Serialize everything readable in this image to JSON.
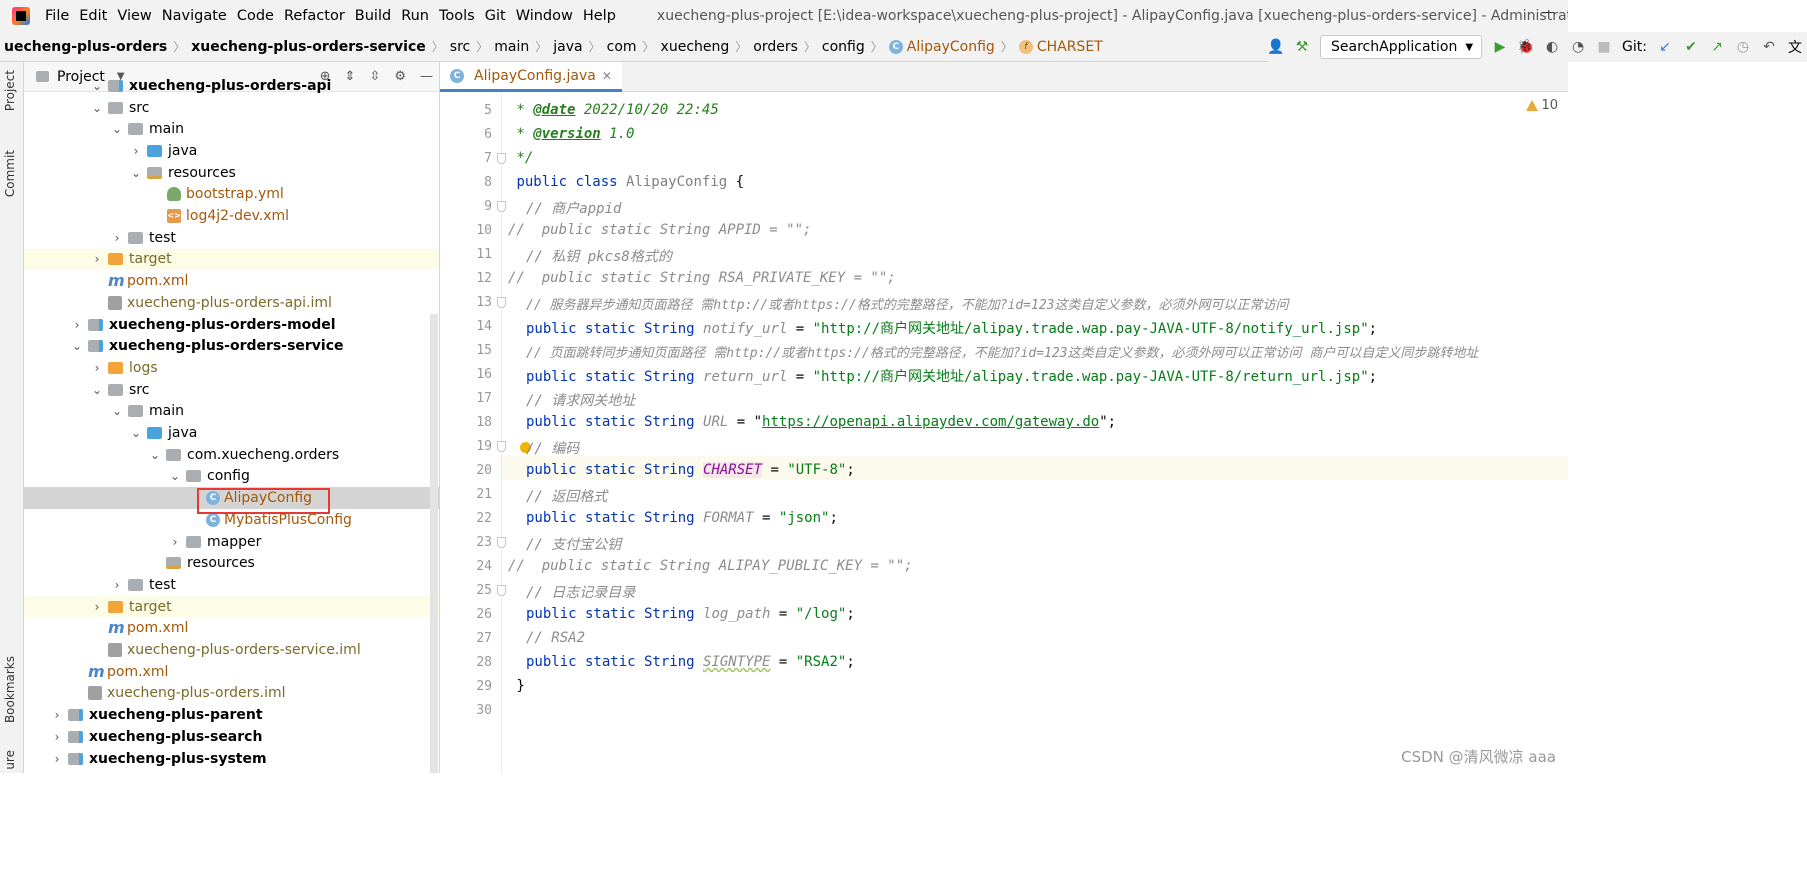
{
  "menubar": {
    "items": [
      "File",
      "Edit",
      "View",
      "Navigate",
      "Code",
      "Refactor",
      "Build",
      "Run",
      "Tools",
      "Git",
      "Window",
      "Help"
    ],
    "title": "xuecheng-plus-project [E:\\idea-workspace\\xuecheng-plus-project] - AlipayConfig.java [xuecheng-plus-orders-service] - Administrator"
  },
  "breadcrumbs": [
    "uecheng-plus-orders",
    "xuecheng-plus-orders-service",
    "src",
    "main",
    "java",
    "com",
    "xuecheng",
    "orders",
    "config",
    "AlipayConfig",
    "CHARSET"
  ],
  "toolbar": {
    "run_config": "SearchApplication",
    "git_label": "Git:"
  },
  "left_strip": {
    "project": "Project",
    "commit": "Commit",
    "bookmarks": "Bookmarks",
    "structure": "ure"
  },
  "project_panel": {
    "title": "Project",
    "rows": [
      {
        "label": "xuecheng-plus-orders-api"
      },
      {
        "label": "src"
      },
      {
        "label": "main"
      },
      {
        "label": "java"
      },
      {
        "label": "resources"
      },
      {
        "label": "bootstrap.yml"
      },
      {
        "label": "log4j2-dev.xml"
      },
      {
        "label": "test"
      },
      {
        "label": "target"
      },
      {
        "label": "pom.xml"
      },
      {
        "label": "xuecheng-plus-orders-api.iml"
      },
      {
        "label": "xuecheng-plus-orders-model"
      },
      {
        "label": "xuecheng-plus-orders-service"
      },
      {
        "label": "logs"
      },
      {
        "label": "src"
      },
      {
        "label": "main"
      },
      {
        "label": "java"
      },
      {
        "label": "com.xuecheng.orders"
      },
      {
        "label": "config"
      },
      {
        "label": "AlipayConfig"
      },
      {
        "label": "MybatisPlusConfig"
      },
      {
        "label": "mapper"
      },
      {
        "label": "resources"
      },
      {
        "label": "test"
      },
      {
        "label": "target"
      },
      {
        "label": "pom.xml"
      },
      {
        "label": "xuecheng-plus-orders-service.iml"
      },
      {
        "label": "pom.xml"
      },
      {
        "label": "xuecheng-plus-orders.iml"
      },
      {
        "label": "xuecheng-plus-parent"
      },
      {
        "label": "xuecheng-plus-search"
      },
      {
        "label": "xuecheng-plus-system"
      }
    ]
  },
  "editor": {
    "tab": "AlipayConfig.java",
    "warnings": "10",
    "line_numbers": [
      "5",
      "6",
      "7",
      "8",
      "9",
      "10",
      "11",
      "12",
      "13",
      "14",
      "15",
      "16",
      "17",
      "18",
      "19",
      "20",
      "21",
      "22",
      "23",
      "24",
      "25",
      "26",
      "27",
      "28",
      "29",
      "30"
    ],
    "code": {
      "l5_tag": "@date",
      "l5_val": " 2022/10/20 22:45",
      "l6_tag": "@version",
      "l6_val": " 1.0",
      "l7": " */",
      "l8_kw": "public class ",
      "l8_cls": "AlipayConfig",
      "l8_brace": " {",
      "l9": "// 商户appid",
      "l10": "//  public static String APPID = \"\";",
      "l11": "// 私钥 pkcs8格式的",
      "l12": "//  public static String RSA_PRIVATE_KEY = \"\";",
      "l13": "// 服务器异步通知页面路径 需http://或者https://格式的完整路径，不能加?id=123这类自定义参数，必须外网可以正常访问",
      "l14_name": "notify_url",
      "l14_val": "\"http://商户网关地址/alipay.trade.wap.pay-JAVA-UTF-8/notify_url.jsp\"",
      "l15": "// 页面跳转同步通知页面路径 需http://或者https://格式的完整路径，不能加?id=123这类自定义参数，必须外网可以正常访问 商户可以自定义同步跳转地址",
      "l16_name": "return_url",
      "l16_val": "\"http://商户网关地址/alipay.trade.wap.pay-JAVA-UTF-8/return_url.jsp\"",
      "l17": "// 请求网关地址",
      "l18_name": "URL",
      "l18_url": "https://openapi.alipaydev.com/gateway.do",
      "l19": "// 编码",
      "l20_name": "CHARSET",
      "l20_val": "\"UTF-8\"",
      "l21": "// 返回格式",
      "l22_name": "FORMAT",
      "l22_val": "\"json\"",
      "l23": "// 支付宝公钥",
      "l24": "//  public static String ALIPAY_PUBLIC_KEY = \"\";",
      "l25": "// 日志记录目录",
      "l26_name": "log_path",
      "l26_val": "\"/log\"",
      "l27": "// RSA2",
      "l28_name": "SIGNTYPE",
      "l28_val": "\"RSA2\"",
      "l29": " }",
      "kw_pss": "public static String "
    }
  },
  "watermark": "CSDN @清风微凉 aaa"
}
